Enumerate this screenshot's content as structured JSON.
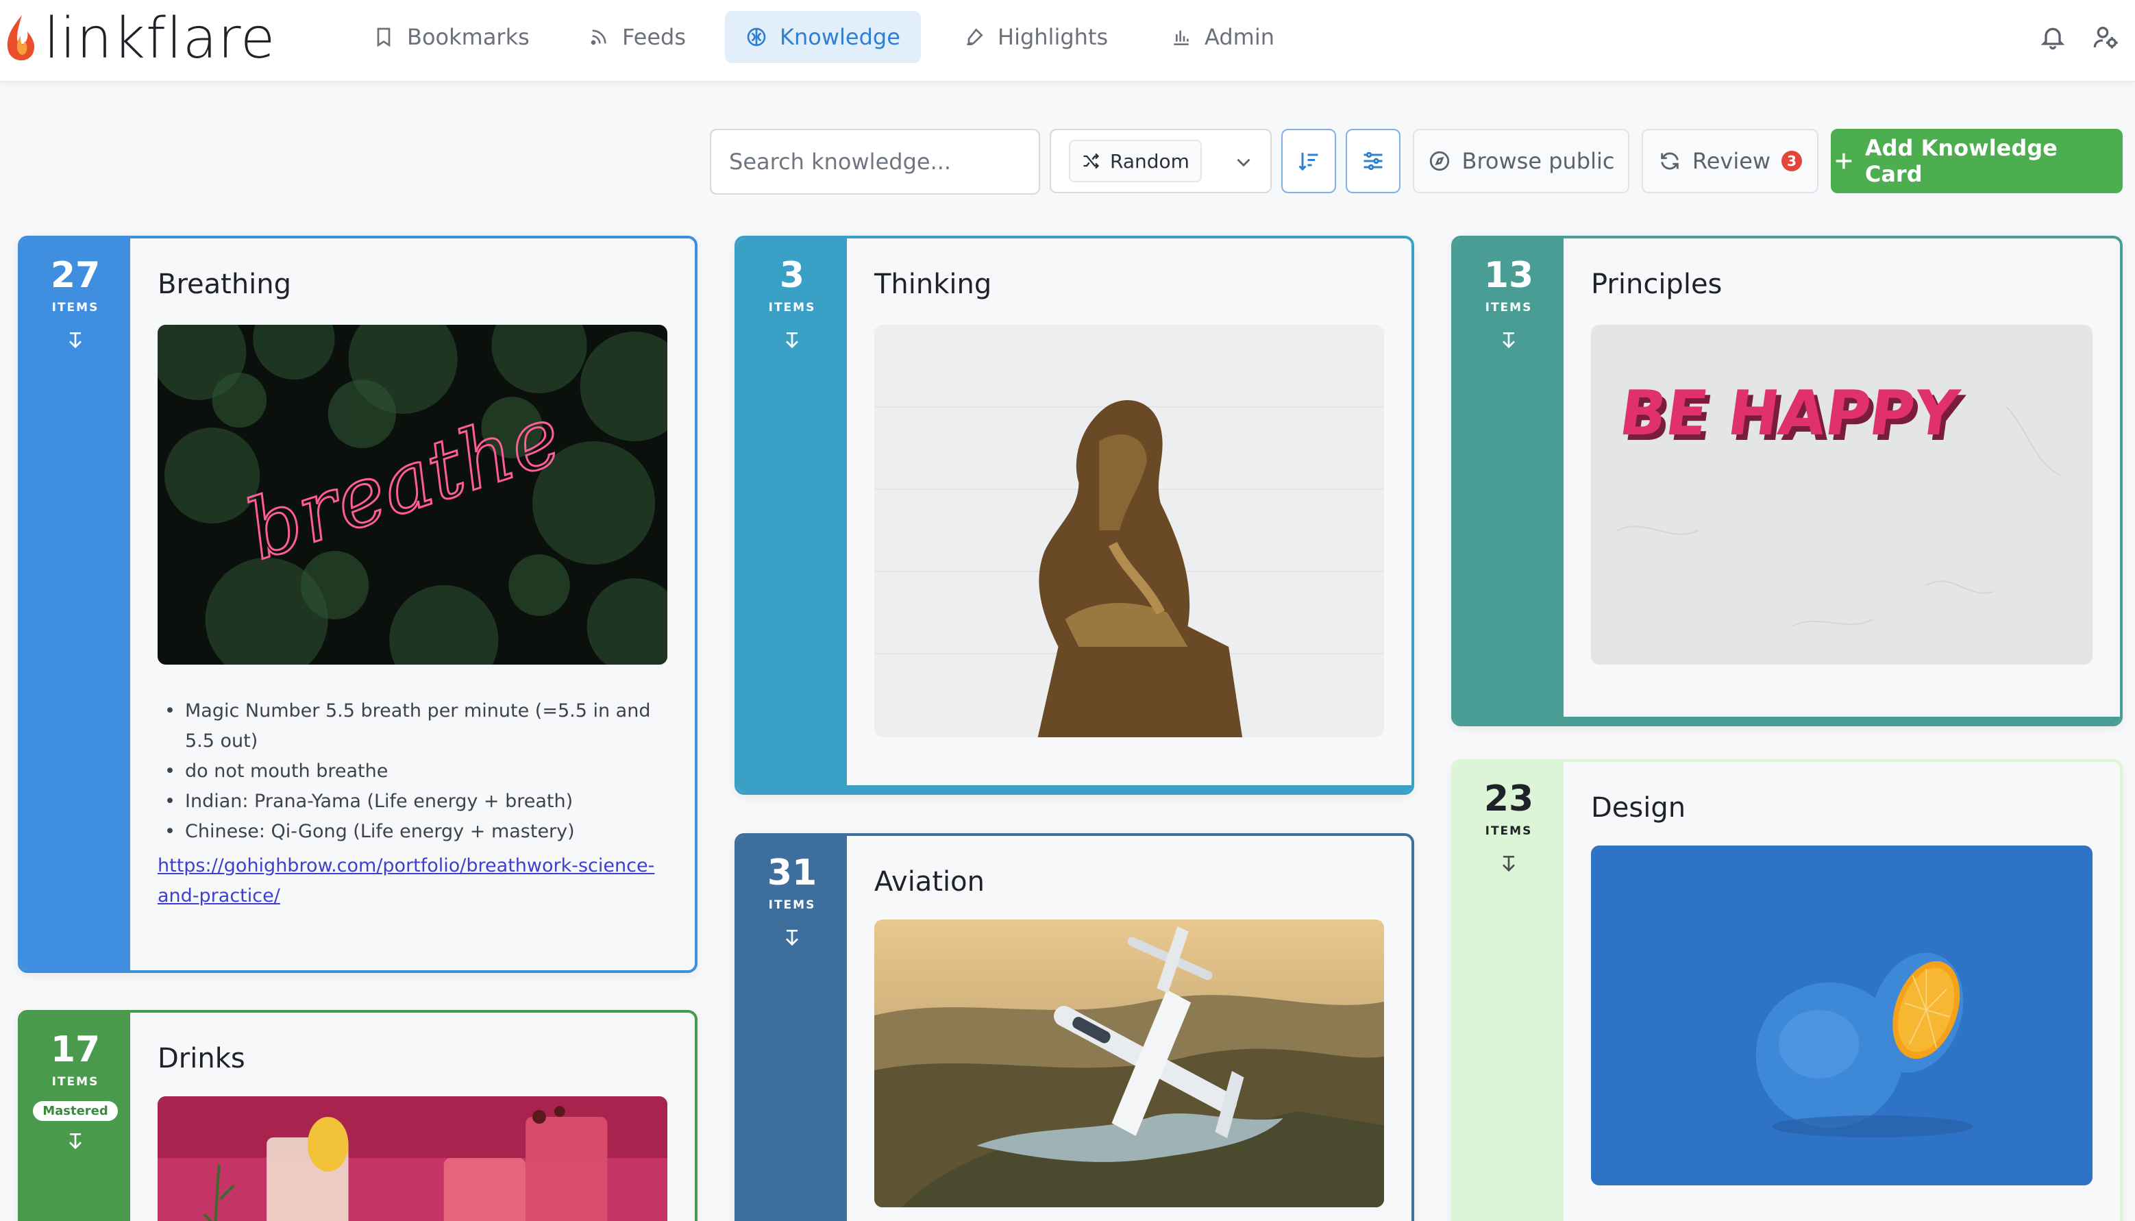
{
  "brand": {
    "name": "linkflare"
  },
  "nav": {
    "items": [
      {
        "label": "Bookmarks",
        "icon": "bookmark-icon"
      },
      {
        "label": "Feeds",
        "icon": "rss-icon"
      },
      {
        "label": "Knowledge",
        "icon": "brain-icon",
        "active": true
      },
      {
        "label": "Highlights",
        "icon": "highlighter-icon"
      },
      {
        "label": "Admin",
        "icon": "bar-chart-icon"
      }
    ],
    "right_icons": [
      "bell-icon",
      "user-settings-icon"
    ]
  },
  "toolbar": {
    "search_placeholder": "Search knowledge...",
    "order_value": "Random",
    "browse_label": "Browse public",
    "review_label": "Review",
    "review_count": "3",
    "add_label": "Add Knowledge Card"
  },
  "colors": {
    "accent": "#2f7fd2",
    "primary_button": "#4cae4f",
    "badge": "#e2453c"
  },
  "cards": [
    {
      "title": "Breathing",
      "count": "27",
      "items_label": "ITEMS",
      "color": "#3f8ee0",
      "notes": [
        "Magic Number 5.5 breath per minute (=5.5 in and 5.5 out)",
        "do not mouth breathe",
        "Indian: Prana-Yama (Life energy + breath)",
        "Chinese: Qi-Gong (Life energy + mastery)"
      ],
      "link": "https://gohighbrow.com/portfolio/breathwork-science-and-practice/"
    },
    {
      "title": "Thinking",
      "count": "3",
      "items_label": "ITEMS",
      "color": "#3aa0c6"
    },
    {
      "title": "Principles",
      "count": "13",
      "items_label": "ITEMS",
      "color": "#4a9d95"
    },
    {
      "title": "Drinks",
      "count": "17",
      "items_label": "ITEMS",
      "color": "#4a9a4e",
      "badge": "Mastered"
    },
    {
      "title": "Aviation",
      "count": "31",
      "items_label": "ITEMS",
      "color": "#3d6e9c"
    },
    {
      "title": "Design",
      "count": "23",
      "items_label": "ITEMS",
      "color": "#dbf5d6"
    }
  ],
  "image_text": {
    "breathe": "breathe",
    "be_happy": "BE HAPPY"
  }
}
